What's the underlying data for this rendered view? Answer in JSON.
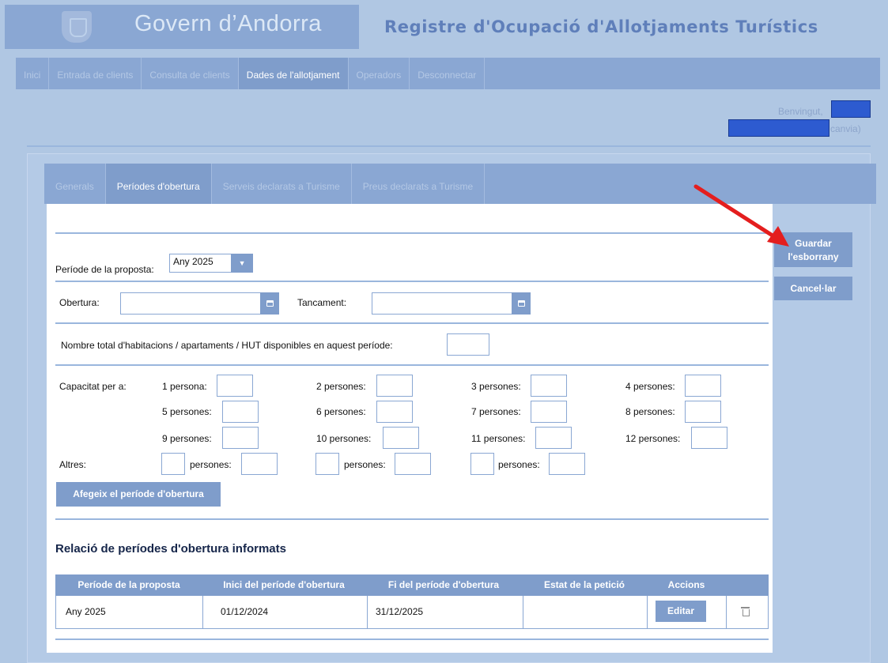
{
  "header": {
    "gov_title": "Govern d’Andorra",
    "app_title": "Registre d'Ocupació d'Allotjaments Turístics"
  },
  "main_nav": [
    {
      "label": "Inici",
      "active": false
    },
    {
      "label": "Entrada de clients",
      "active": false
    },
    {
      "label": "Consulta de clients",
      "active": false
    },
    {
      "label": "Dades de l'allotjament",
      "active": true
    },
    {
      "label": "Operadors",
      "active": false
    },
    {
      "label": "Desconnectar",
      "active": false
    }
  ],
  "welcome": {
    "greeting": "Benvingut,",
    "change": "canvia)"
  },
  "sub_nav": [
    {
      "label": "Generals",
      "active": false
    },
    {
      "label": "Períodes d'obertura",
      "active": true
    },
    {
      "label": "Serveis declarats a Turisme",
      "active": false
    },
    {
      "label": "Preus declarats a Turisme",
      "active": false
    }
  ],
  "form": {
    "period_label": "Període de la proposta:",
    "period_value": "Any 2025",
    "opening_label": "Obertura:",
    "closing_label": "Tancament:",
    "total_rooms_label": "Nombre total d'habitacions / apartaments / HUT disponibles en aquest període:",
    "capacity_label": "Capacitat per a:",
    "capacity": [
      "1 persona:",
      "2 persones:",
      "3 persones:",
      "4 persones:",
      "5 persones:",
      "6 persones:",
      "7 persones:",
      "8 persones:",
      "9 persones:",
      "10 persones:",
      "11 persones:",
      "12 persones:"
    ],
    "others_label": "Altres:",
    "others_persons": "persones:",
    "add_button": "Afegeix el període d'obertura"
  },
  "actions": {
    "save_draft": "Guardar l'esborrany",
    "cancel": "Cancel·lar"
  },
  "table": {
    "title": "Relació de períodes d'obertura informats",
    "headers": [
      "Període de la proposta",
      "Inici del període d'obertura",
      "Fi del període d'obertura",
      "Estat de la petició",
      "Accions"
    ],
    "rows": [
      {
        "period": "Any 2025",
        "start": "01/12/2024",
        "end": "31/12/2025",
        "status": "",
        "edit": "Editar"
      }
    ]
  },
  "colors": {
    "accent": "#7f9dcb",
    "background": "#b0c7e3",
    "annotation_arrow": "#e41e1e"
  }
}
